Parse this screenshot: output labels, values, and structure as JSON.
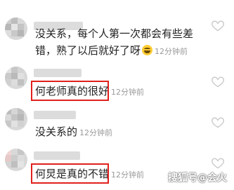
{
  "comments": [
    {
      "text": "没关系，每个人第一次都会有些差错，熟了以后就好了呀",
      "time": "12分钟前",
      "has_emoji": true
    },
    {
      "text": "何老师真的很好",
      "time": "12分钟前",
      "highlighted": true
    },
    {
      "text": "没关系的",
      "time": "12分钟前"
    },
    {
      "text": "何炅是真的不错",
      "time": "12分钟前",
      "highlighted": true
    }
  ],
  "watermark": "搜狐号@会火",
  "colors": {
    "highlight_border": "#e0201c",
    "time_text": "#9a9a9a",
    "heart_outline": "#cccccc"
  },
  "icons": {
    "like": "heart-outline-icon",
    "emoji": "grinning-face-emoji"
  }
}
